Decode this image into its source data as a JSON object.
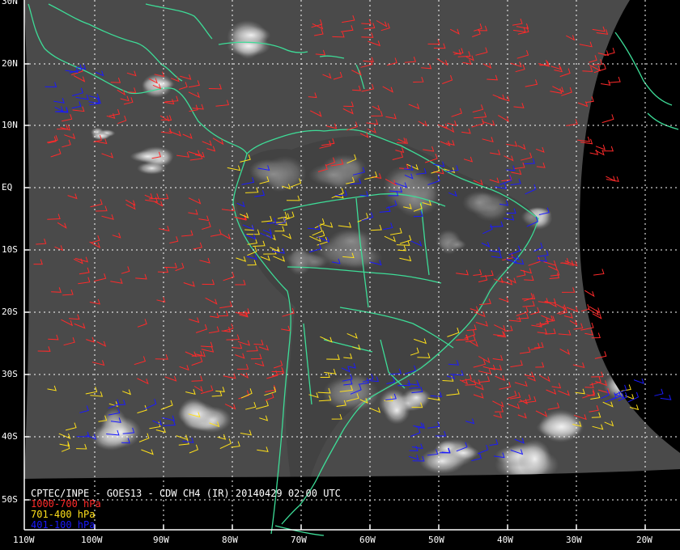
{
  "map": {
    "title": "CPTEC/INPE - GOES13 - CDW CH4 (IR) 20140429 02:00 UTC",
    "projection": "geostationary view, South America / tropical Atlantic",
    "background": "infrared satellite imagery (grayscale)",
    "latitude_labels": [
      "30N",
      "20N",
      "10N",
      "EQ",
      "10S",
      "20S",
      "30S",
      "40S",
      "50S"
    ],
    "longitude_labels": [
      "110W",
      "100W",
      "90W",
      "80W",
      "70W",
      "60W",
      "50W",
      "40W",
      "30W",
      "20W"
    ],
    "colors": {
      "coastline": "#3ddc97",
      "grid": "#ffffff",
      "low_level": "#ff2a2a",
      "mid_level": "#ffe01a",
      "high_level": "#1a1aff"
    },
    "legend": [
      {
        "label": "1000-700 hPa",
        "color": "#ff2a2a"
      },
      {
        "label": "701-400 hPa",
        "color": "#ffe01a"
      },
      {
        "label": "401-100 hPa",
        "color": "#1a1aff"
      }
    ]
  }
}
